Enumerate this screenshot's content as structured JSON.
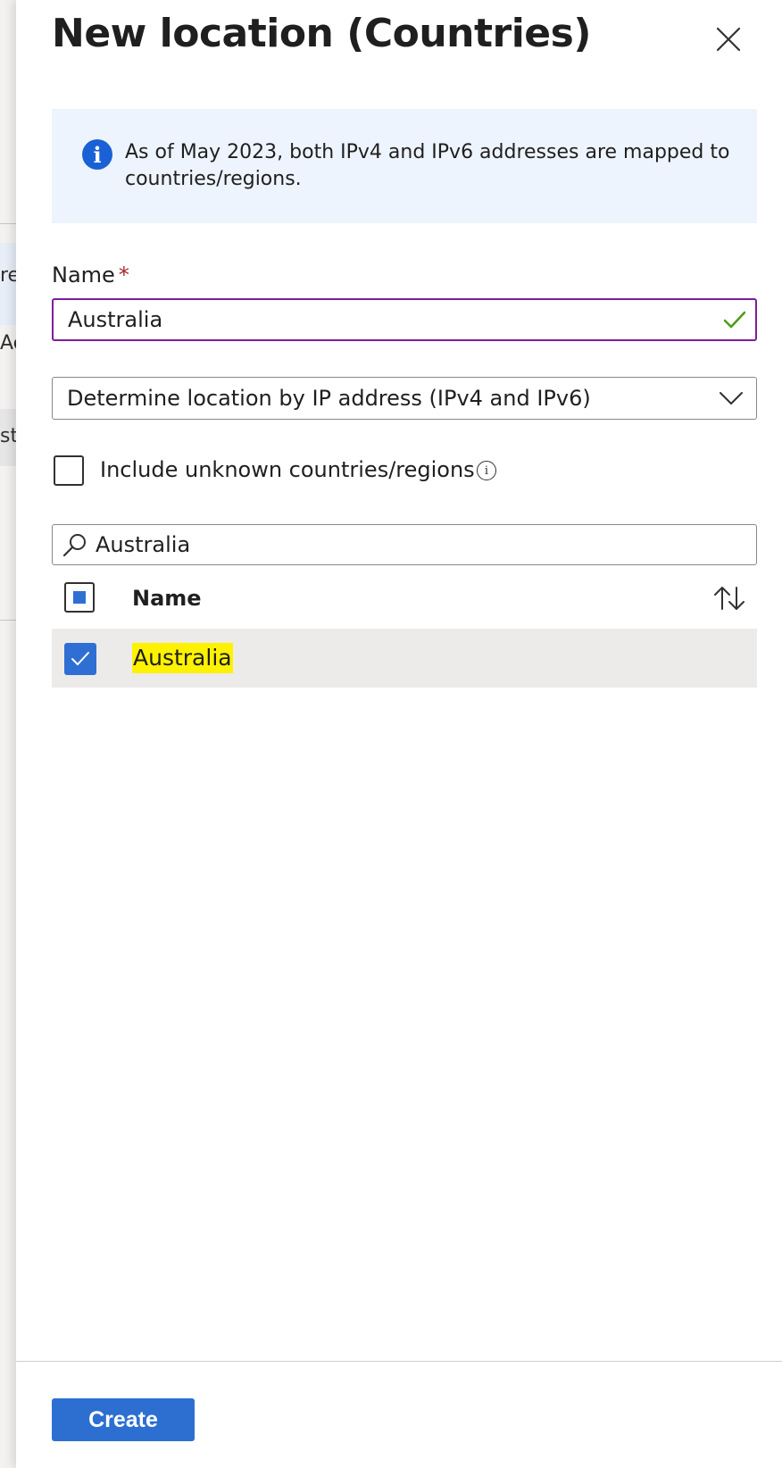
{
  "background": {
    "fragments": [
      "re",
      "Ac",
      "st"
    ]
  },
  "panel": {
    "title": "New location (Countries)",
    "close_icon": "close-icon"
  },
  "info_banner": {
    "icon": "info-icon",
    "icon_glyph": "i",
    "text": "As of May 2023, both IPv4 and IPv6 addresses are mapped to countries/regions."
  },
  "name_field": {
    "label": "Name",
    "required_marker": "*",
    "value": "Australia",
    "valid_icon": "checkmark-icon"
  },
  "method_dropdown": {
    "selected": "Determine location by IP address (IPv4 and IPv6)",
    "chevron_icon": "chevron-down-icon"
  },
  "include_unknown": {
    "label": "Include unknown countries/regions",
    "checked": false,
    "info_icon": "info-icon",
    "info_glyph": "i"
  },
  "search": {
    "value": "Australia",
    "icon": "search-icon"
  },
  "country_list": {
    "column_header": "Name",
    "select_all_state": "indeterminate",
    "sort_icon": "sort-icon",
    "rows": [
      {
        "name": "Australia",
        "checked": true,
        "highlight": "#fff200"
      }
    ]
  },
  "footer": {
    "create_label": "Create"
  },
  "colors": {
    "accent_blue": "#2c6fd1",
    "focus_border": "#7a1e9e",
    "valid_green": "#4f9a16",
    "info_banner_bg": "#eef4fd",
    "required_red": "#a4262c"
  }
}
